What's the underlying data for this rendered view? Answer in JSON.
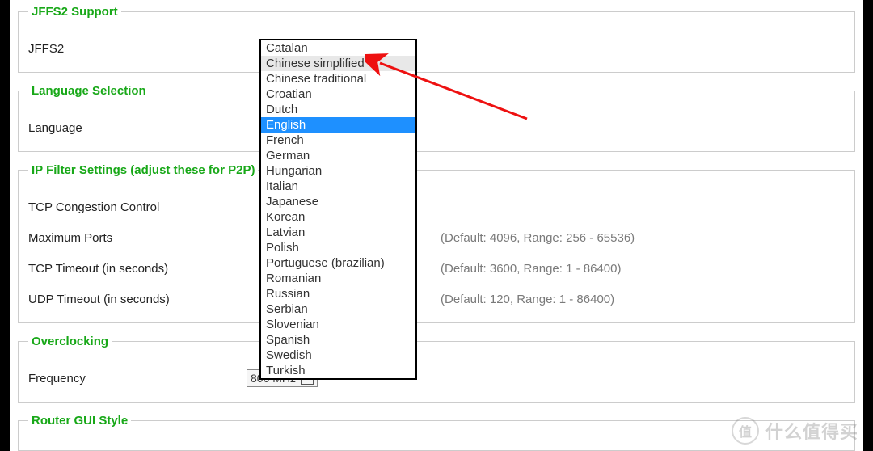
{
  "sections": {
    "jffs2": {
      "legend": "JFFS2 Support",
      "row_label": "JFFS2"
    },
    "language": {
      "legend": "Language Selection",
      "row_label": "Language"
    },
    "ipfilter": {
      "legend": "IP Filter Settings (adjust these for P2P)",
      "tcp_cc_label": "TCP Congestion Control",
      "maxports_label": "Maximum Ports",
      "maxports_hint": "(Default: 4096, Range: 256 - 65536)",
      "tcptimeout_label": "TCP Timeout (in seconds)",
      "tcptimeout_hint": "(Default: 3600, Range: 1 - 86400)",
      "udptimeout_label": "UDP Timeout (in seconds)",
      "udptimeout_hint": "(Default: 120, Range: 1 - 86400)"
    },
    "overclocking": {
      "legend": "Overclocking",
      "freq_label": "Frequency",
      "freq_value": "800 MHz"
    },
    "gui_style": {
      "legend": "Router GUI Style"
    }
  },
  "language_dropdown": {
    "options": [
      "Catalan",
      "Chinese simplified",
      "Chinese traditional",
      "Croatian",
      "Dutch",
      "English",
      "French",
      "German",
      "Hungarian",
      "Italian",
      "Japanese",
      "Korean",
      "Latvian",
      "Polish",
      "Portuguese (brazilian)",
      "Romanian",
      "Russian",
      "Serbian",
      "Slovenian",
      "Spanish",
      "Swedish",
      "Turkish"
    ],
    "hover_index": 1,
    "selected_index": 5
  },
  "watermark": {
    "badge": "值",
    "text": "什么值得买"
  },
  "colors": {
    "legend": "#18a818",
    "hint": "#7a7a7a",
    "select_highlight": "#1e90ff"
  }
}
